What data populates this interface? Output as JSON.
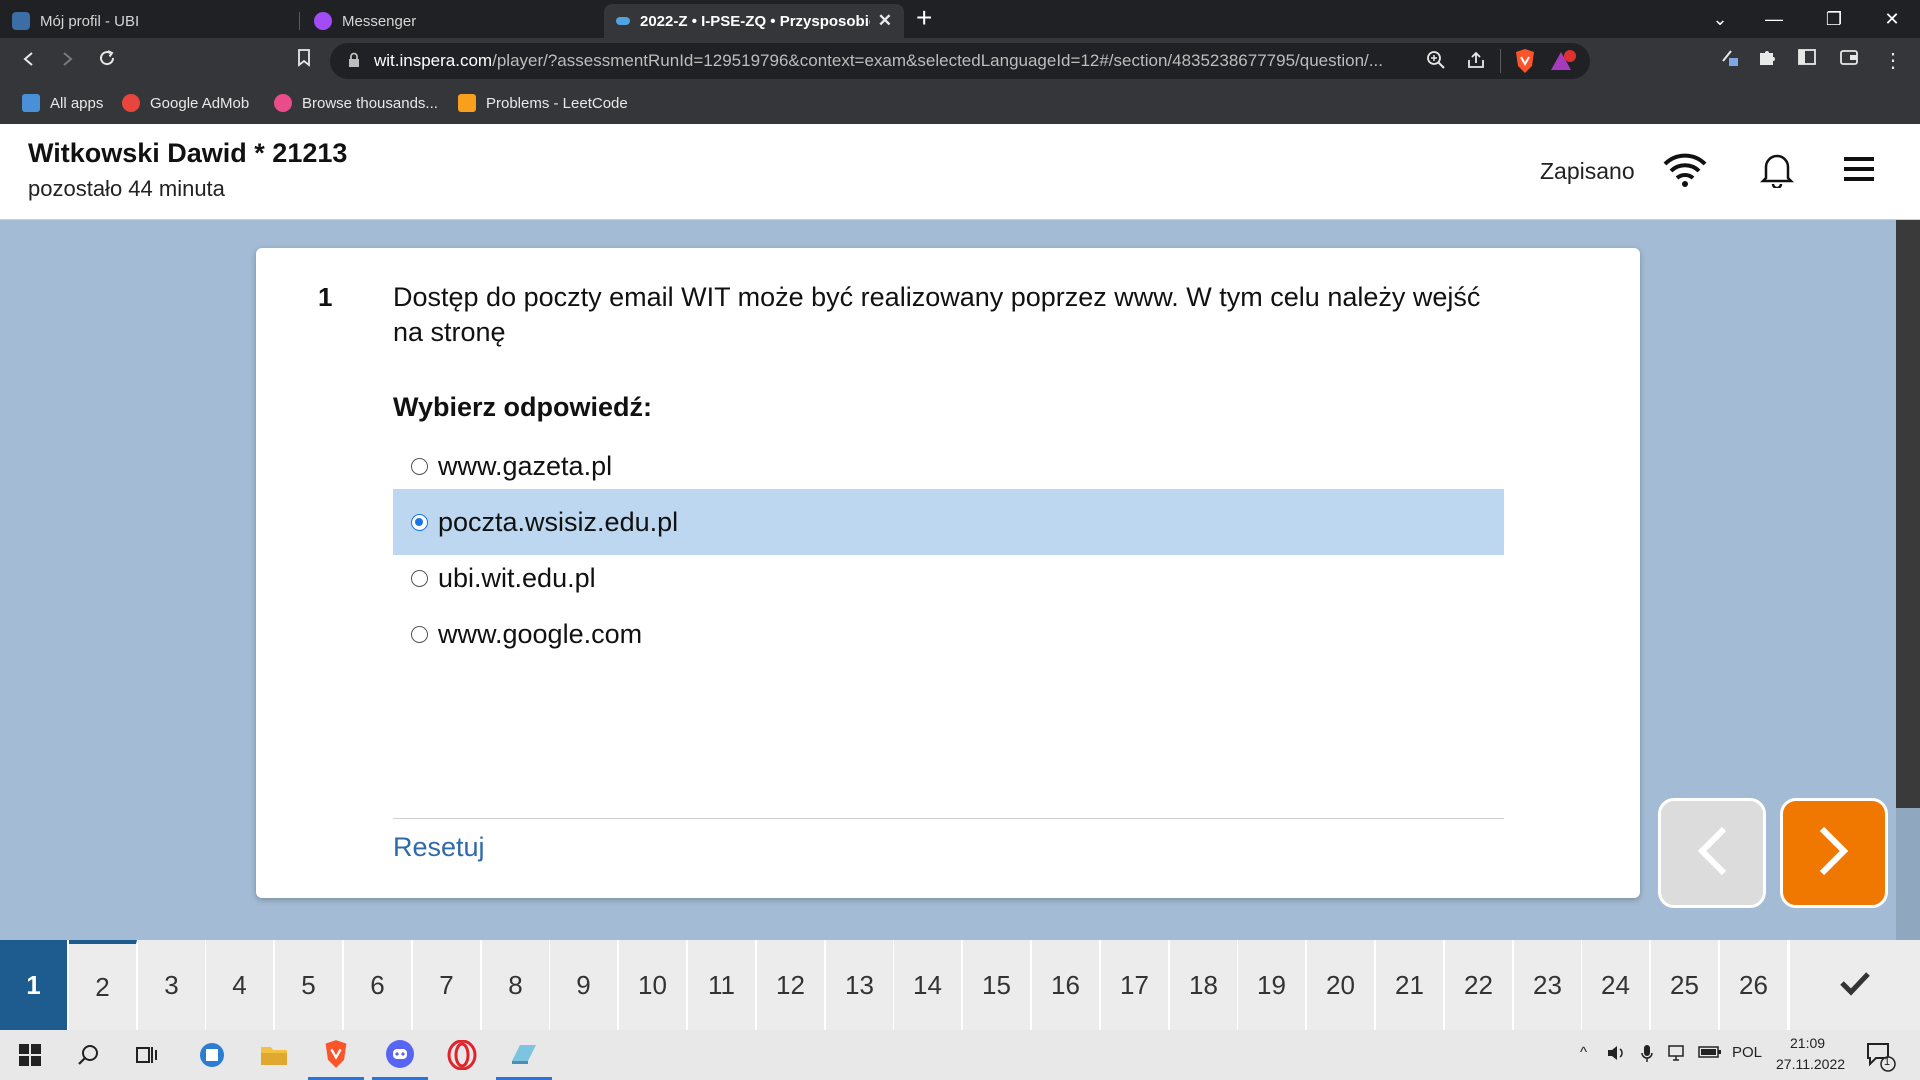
{
  "browser": {
    "tabs": [
      {
        "title": "Mój profil - UBI",
        "color": "#3b6ea5"
      },
      {
        "title": "Messenger",
        "color": "#a24cf6"
      },
      {
        "title": "2022-Z • I-PSE-ZQ • Przysposobie",
        "color": "#4fa3e0"
      }
    ],
    "new_tab_label": "+",
    "url_host": "wit.inspera.com",
    "url_path": "/player/?assessmentRunId=129519796&context=exam&selectedLanguageId=12#/section/4835238677795/question/...",
    "bookmarks": [
      {
        "label": "All apps",
        "icon_color": "#4a90d9"
      },
      {
        "label": "Google AdMob",
        "icon_color": "#e8453c"
      },
      {
        "label": "Browse thousands...",
        "icon_color": "#ea4c89"
      },
      {
        "label": "Problems - LeetCode",
        "icon_color": "#f89f1b"
      }
    ]
  },
  "header": {
    "candidate": "Witkowski Dawid * 21213",
    "time_left": "pozostało 44 minuta",
    "saved_status": "Zapisano"
  },
  "question": {
    "number": "1",
    "text": "Dostęp do poczty email WIT może być realizowany poprzez www. W tym celu należy wejść na stronę",
    "prompt": "Wybierz odpowiedź:",
    "options": [
      {
        "label": "www.gazeta.pl",
        "selected": false
      },
      {
        "label": "poczta.wsisiz.edu.pl",
        "selected": true
      },
      {
        "label": "ubi.wit.edu.pl",
        "selected": false
      },
      {
        "label": "www.google.com",
        "selected": false
      }
    ],
    "reset_label": "Resetuj"
  },
  "navigator": {
    "current": 1,
    "items": [
      "1",
      "2",
      "3",
      "4",
      "5",
      "6",
      "7",
      "8",
      "9",
      "10",
      "11",
      "12",
      "13",
      "14",
      "15",
      "16",
      "17",
      "18",
      "19",
      "20",
      "21",
      "22",
      "23",
      "24",
      "25",
      "26"
    ]
  },
  "taskbar": {
    "language": "POL",
    "time": "21:09",
    "date": "27.11.2022",
    "notification_count": "1"
  },
  "colors": {
    "accent_blue": "#1e5b8e",
    "next_orange": "#f07800",
    "selected_bg": "#bcd7ef",
    "page_bg": "#a3bbd4"
  }
}
